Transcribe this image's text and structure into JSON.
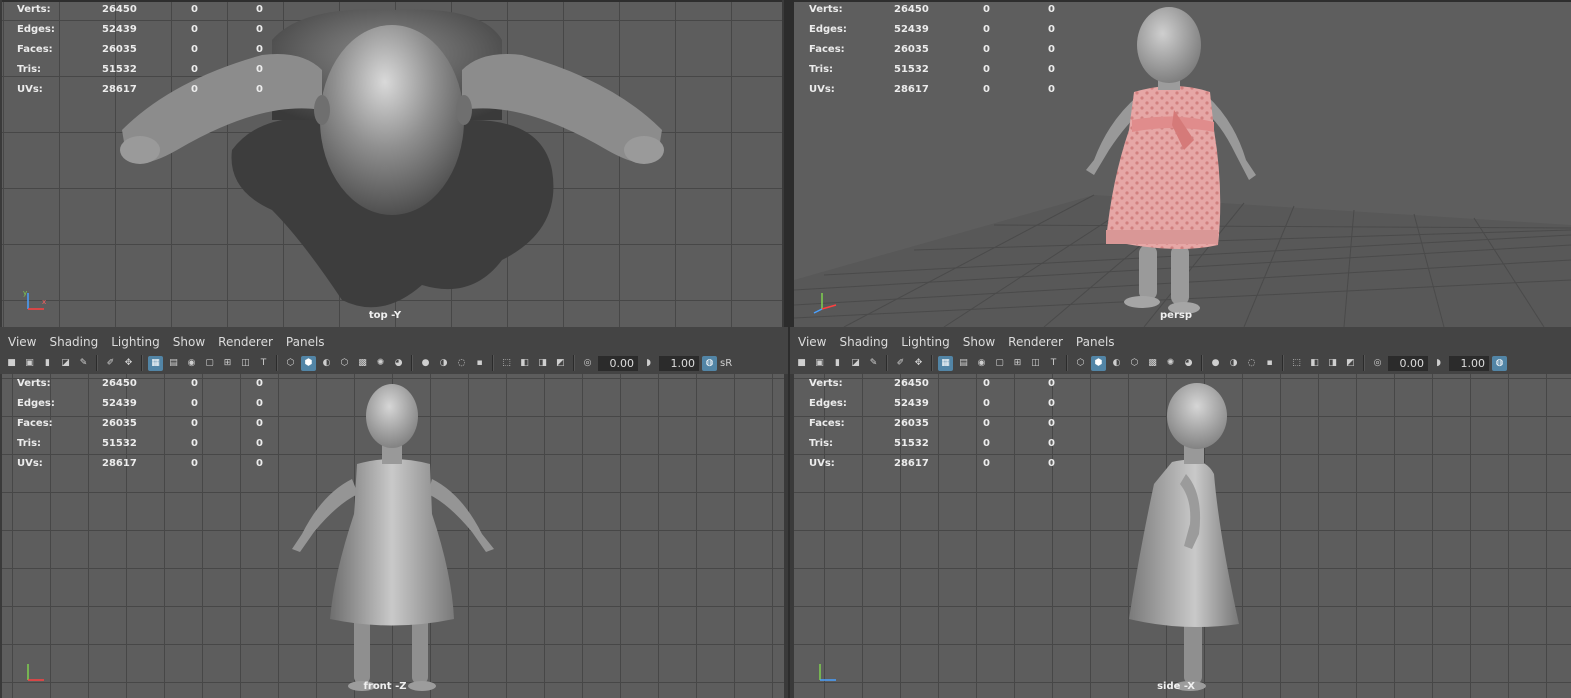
{
  "stats": [
    {
      "label": "Verts:",
      "v1": "26450",
      "v2": "0",
      "v3": "0"
    },
    {
      "label": "Edges:",
      "v1": "52439",
      "v2": "0",
      "v3": "0"
    },
    {
      "label": "Faces:",
      "v1": "26035",
      "v2": "0",
      "v3": "0"
    },
    {
      "label": "Tris:",
      "v1": "51532",
      "v2": "0",
      "v3": "0"
    },
    {
      "label": "UVs:",
      "v1": "28617",
      "v2": "0",
      "v3": "0"
    }
  ],
  "viewports": {
    "top": {
      "camera": "top -Y"
    },
    "persp": {
      "camera": "persp"
    },
    "front": {
      "camera": "front -Z"
    },
    "side": {
      "camera": "side -X"
    }
  },
  "menu": [
    "View",
    "Shading",
    "Lighting",
    "Show",
    "Renderer",
    "Panels"
  ],
  "toolbar": {
    "field_a": "0.00",
    "field_b": "1.00",
    "srgb_label": "sR"
  },
  "colors": {
    "viewport_bg": "#5d5d5d",
    "grid": "#474747",
    "active_toggle": "#5285a6",
    "dress_pink": "#e9a7a5"
  }
}
